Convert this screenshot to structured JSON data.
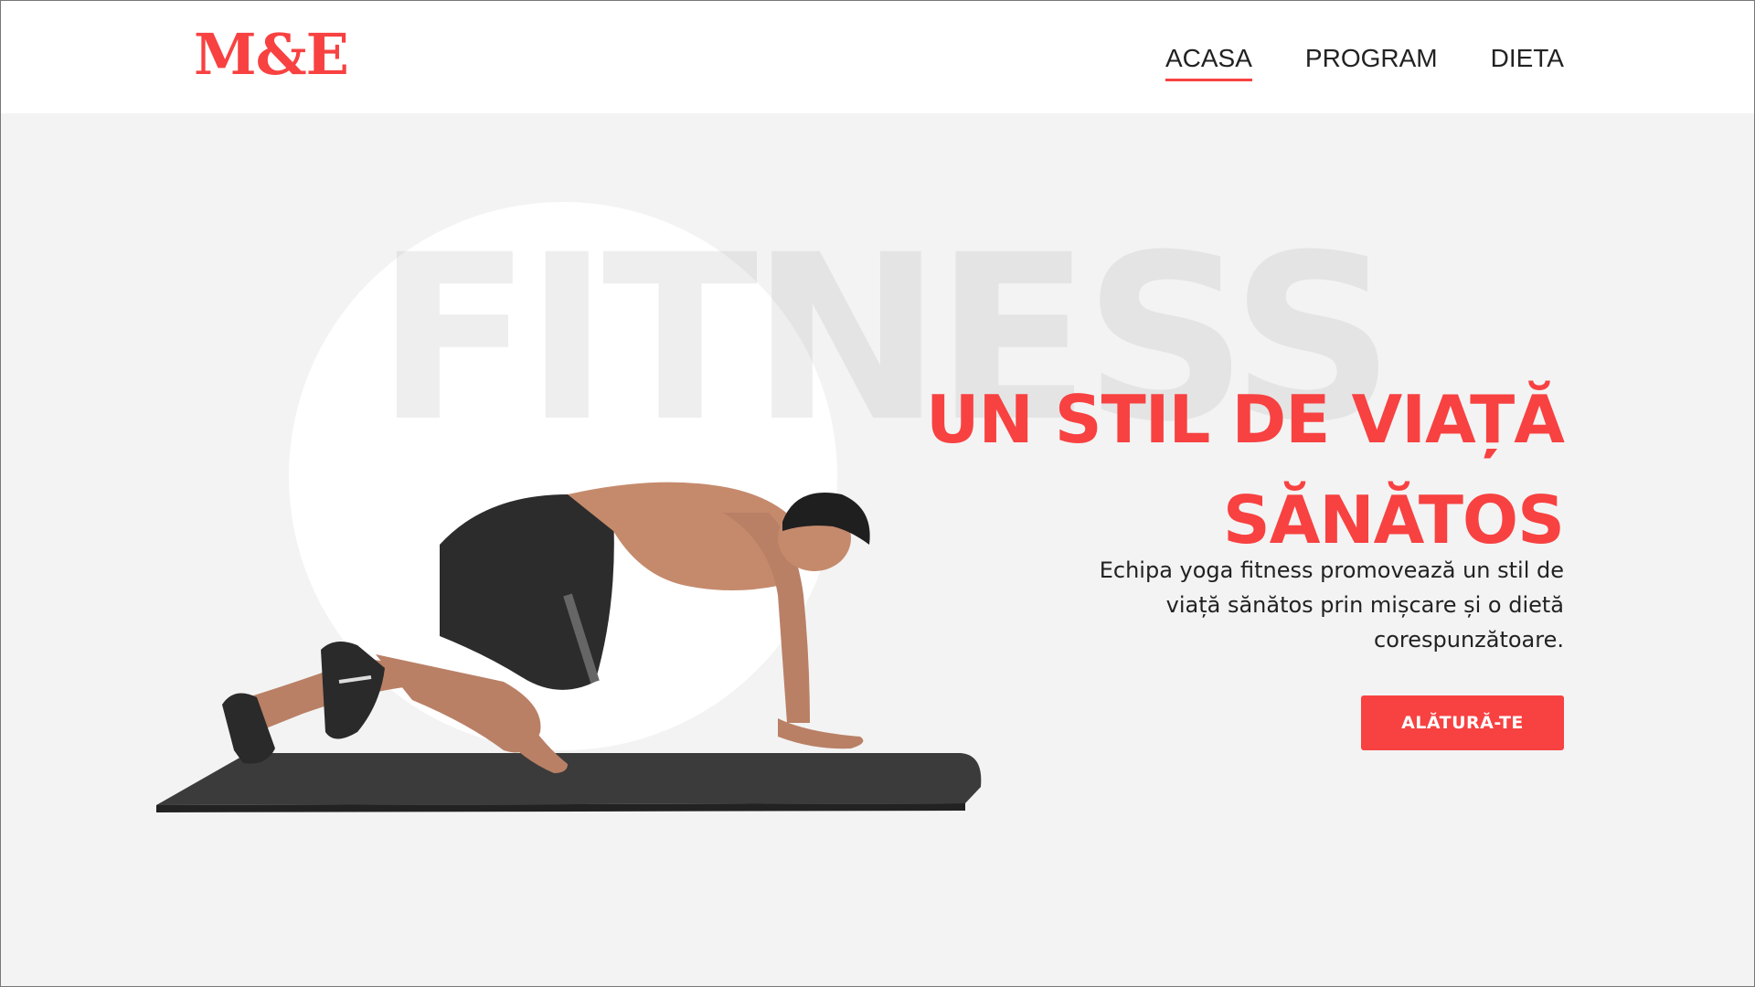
{
  "header": {
    "logo": "M&E",
    "nav": [
      {
        "label": "ACASA",
        "active": true
      },
      {
        "label": "PROGRAM",
        "active": false
      },
      {
        "label": "DIETA",
        "active": false
      }
    ]
  },
  "hero": {
    "watermark": "FITNESS",
    "title_line1": "UN STIL DE VIAȚĂ",
    "title_line2": "SĂNĂTOS",
    "description": "Echipa yoga fitness promovează un stil de viață sănătos prin mișcare și o dietă corespunzătoare.",
    "cta_label": "ALĂTURĂ-TE"
  },
  "colors": {
    "accent": "#f84141",
    "background": "#f3f3f3",
    "header_bg": "#ffffff",
    "text": "#222222"
  },
  "icons": [
    "man-exercising-illustration"
  ]
}
